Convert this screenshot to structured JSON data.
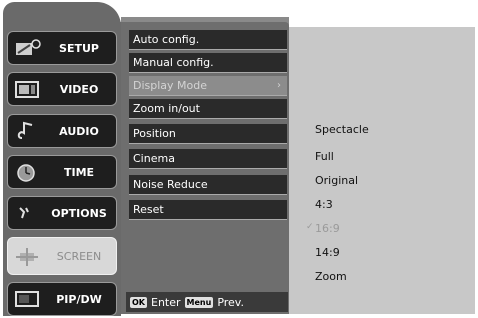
{
  "tabs": [
    {
      "label": "SETUP",
      "icon": "setup-icon"
    },
    {
      "label": "VIDEO",
      "icon": "video-icon"
    },
    {
      "label": "AUDIO",
      "icon": "audio-icon"
    },
    {
      "label": "TIME",
      "icon": "time-icon"
    },
    {
      "label": "OPTIONS",
      "icon": "options-icon"
    },
    {
      "label": "SCREEN",
      "icon": "screen-icon",
      "active": true
    },
    {
      "label": "PIP/DW",
      "icon": "pip-icon"
    }
  ],
  "menu": {
    "items": [
      {
        "label": "Auto config."
      },
      {
        "label": "Manual config."
      },
      {
        "label": "Display Mode",
        "selected": true,
        "arrow": "›"
      },
      {
        "label": "Zoom in/out"
      },
      {
        "label": "Position"
      },
      {
        "label": "Cinema"
      },
      {
        "label": "Noise Reduce"
      },
      {
        "label": "Reset"
      }
    ]
  },
  "hints": {
    "enter_key": "OK",
    "enter_label": "Enter",
    "prev_key": "Menu",
    "prev_label": "Prev."
  },
  "submenu": {
    "options": [
      {
        "label": "Spectacle"
      },
      {
        "label": "Full"
      },
      {
        "label": "Original"
      },
      {
        "label": "4:3"
      },
      {
        "label": "16:9",
        "current": true
      },
      {
        "label": "14:9"
      },
      {
        "label": "Zoom"
      }
    ]
  },
  "colors": {
    "panel": "#6a6a6a",
    "tab": "#1e1e1e",
    "active_tab": "#d8d8d8",
    "submenu_bg": "#c8c8c8"
  }
}
